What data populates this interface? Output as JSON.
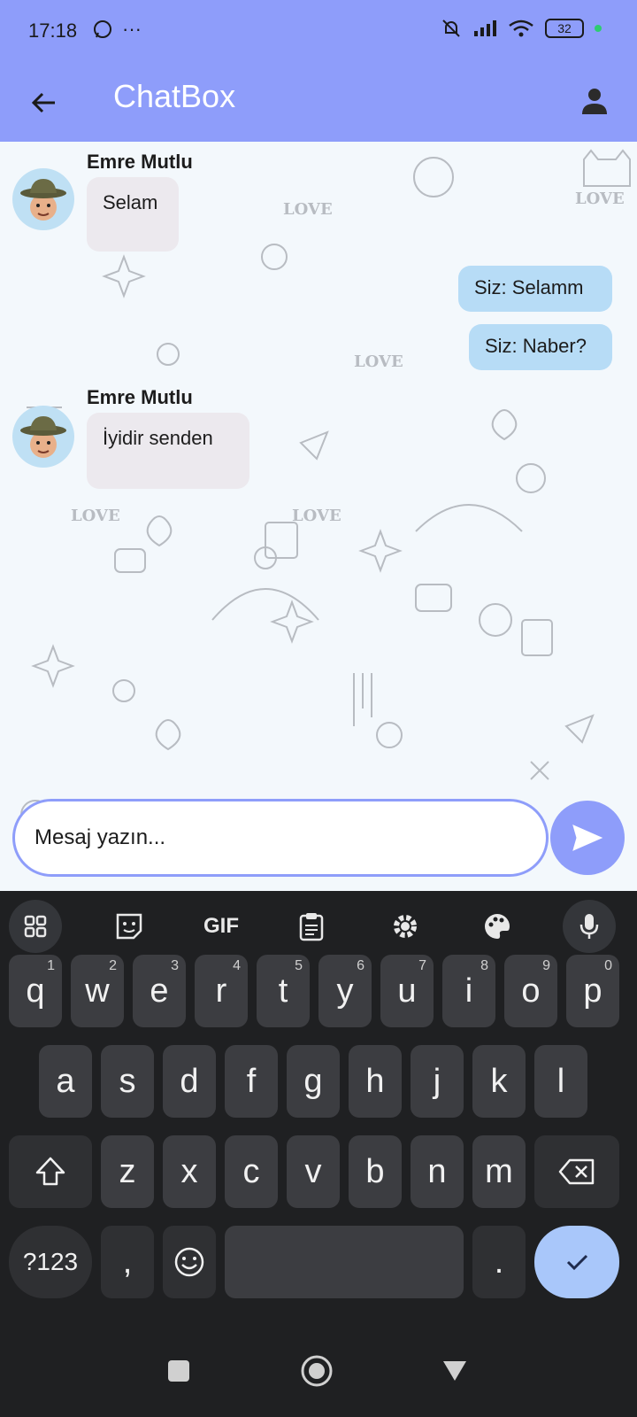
{
  "status_bar": {
    "time": "17:18",
    "battery": "32"
  },
  "app_bar": {
    "title": "ChatBox"
  },
  "messages": [
    {
      "sender": "Emre Mutlu",
      "text": "Selam",
      "direction": "in"
    },
    {
      "text": "Siz: Selamm",
      "direction": "out"
    },
    {
      "text": "Siz: Naber?",
      "direction": "out"
    },
    {
      "sender": "Emre Mutlu",
      "text": "İyidir senden",
      "direction": "in"
    }
  ],
  "composer": {
    "placeholder": "Mesaj yazın..."
  },
  "keyboard": {
    "toolbar": {
      "gif_label": "GIF"
    },
    "row1": [
      {
        "key": "q",
        "hint": "1"
      },
      {
        "key": "w",
        "hint": "2"
      },
      {
        "key": "e",
        "hint": "3"
      },
      {
        "key": "r",
        "hint": "4"
      },
      {
        "key": "t",
        "hint": "5"
      },
      {
        "key": "y",
        "hint": "6"
      },
      {
        "key": "u",
        "hint": "7"
      },
      {
        "key": "i",
        "hint": "8"
      },
      {
        "key": "o",
        "hint": "9"
      },
      {
        "key": "p",
        "hint": "0"
      }
    ],
    "row2": [
      "a",
      "s",
      "d",
      "f",
      "g",
      "h",
      "j",
      "k",
      "l"
    ],
    "row3": [
      "z",
      "x",
      "c",
      "v",
      "b",
      "n",
      "m"
    ],
    "symbols_label": "?123",
    "comma": ",",
    "period": "."
  },
  "colors": {
    "accent": "#8e9dfa",
    "incoming_bubble": "#ece9ee",
    "outgoing_bubble": "#b7dcf6",
    "keyboard_bg": "#1f2022"
  }
}
